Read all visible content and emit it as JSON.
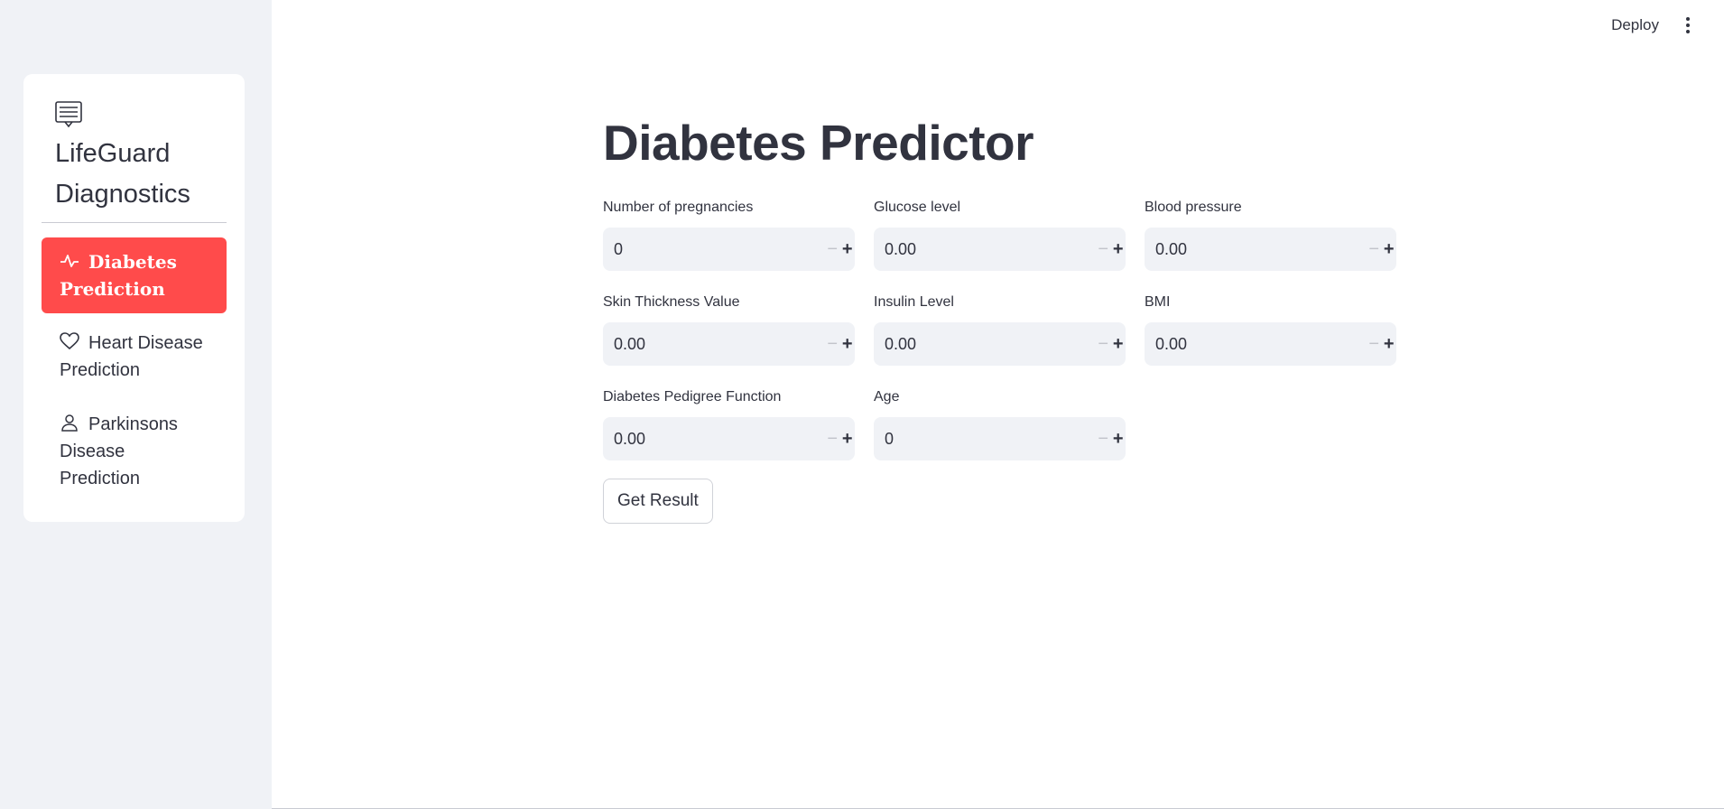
{
  "sidebar": {
    "brand": {
      "icon": "document-list-icon",
      "title": "LifeGuard Diagnostics"
    },
    "items": [
      {
        "icon": "activity-icon",
        "label": "Diabetes Prediction",
        "active": true
      },
      {
        "icon": "heart-icon",
        "label": "Heart Disease Prediction",
        "active": false
      },
      {
        "icon": "person-icon",
        "label": "Parkinsons Disease Prediction",
        "active": false
      }
    ],
    "active_color": "#ff4b4b"
  },
  "header": {
    "deploy_label": "Deploy",
    "menu_icon": "kebab-menu-icon"
  },
  "main": {
    "title": "Diabetes Predictor",
    "fields": [
      {
        "label": "Number of pregnancies",
        "value": "0"
      },
      {
        "label": "Glucose level",
        "value": "0.00"
      },
      {
        "label": "Blood pressure",
        "value": "0.00"
      },
      {
        "label": "Skin Thickness Value",
        "value": "0.00"
      },
      {
        "label": "Insulin Level",
        "value": "0.00"
      },
      {
        "label": "BMI",
        "value": "0.00"
      },
      {
        "label": "Diabetes Pedigree Function",
        "value": "0.00"
      },
      {
        "label": "Age",
        "value": "0"
      }
    ],
    "stepper": {
      "minus": "−",
      "plus": "+"
    },
    "submit_label": "Get Result"
  }
}
